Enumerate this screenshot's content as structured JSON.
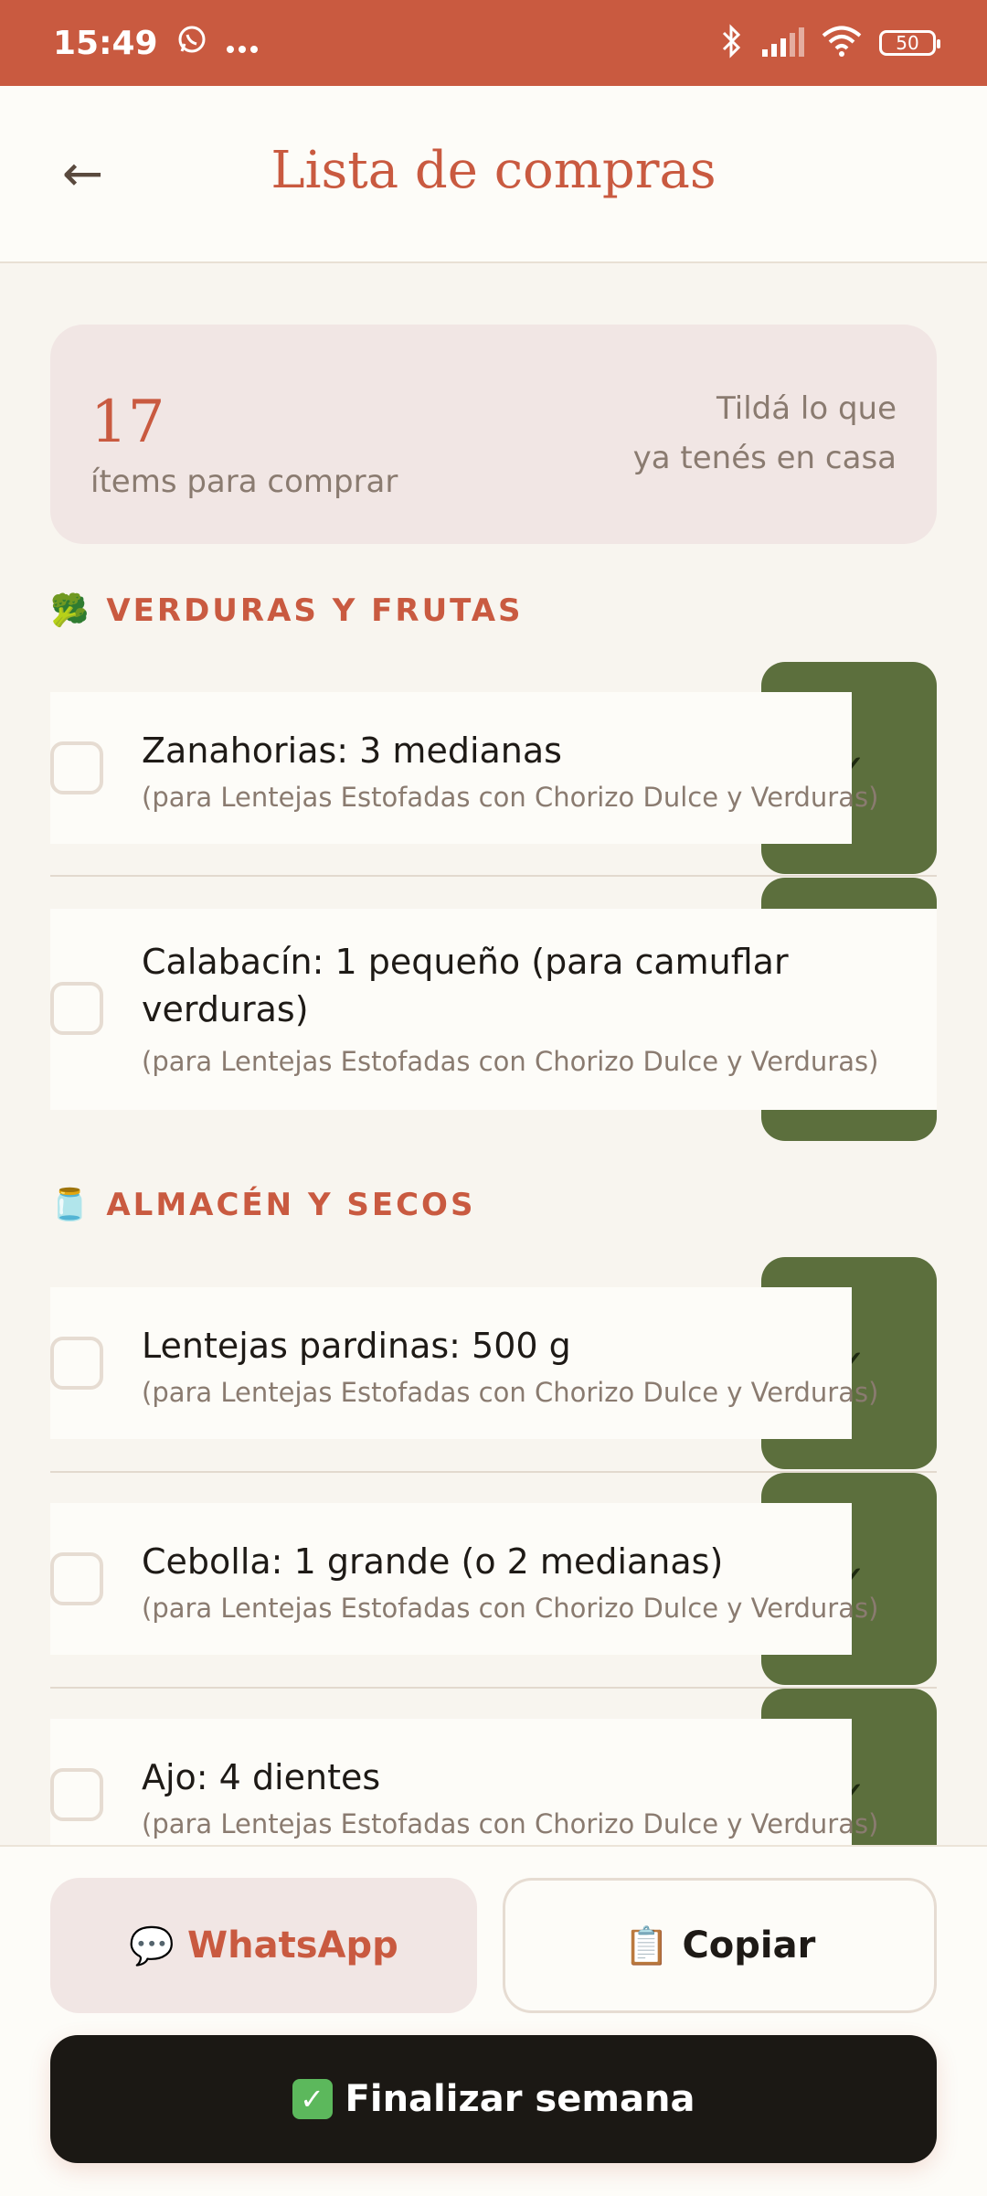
{
  "status": {
    "time": "15:49",
    "battery": "50"
  },
  "header": {
    "back": "←",
    "title": "Lista de compras"
  },
  "summary": {
    "count": "17",
    "count_label": "ítems para comprar",
    "hint_line1": "Tildá lo que",
    "hint_line2": "ya tenés en casa"
  },
  "sections": [
    {
      "icon": "🥦",
      "title": "VERDURAS Y FRUTAS",
      "items": [
        {
          "name": "Zanahorias: 3 medianas",
          "note": "(para Lentejas Estofadas con Chorizo Dulce y Verduras)"
        },
        {
          "name_line1": "Calabacín: 1 pequeño (para camuflar",
          "name_line2": "verduras)",
          "note": "(para Lentejas Estofadas con Chorizo Dulce y Verduras)"
        }
      ]
    },
    {
      "icon": "🫙",
      "title": "ALMACÉN Y SECOS",
      "items": [
        {
          "name": "Lentejas pardinas: 500 g",
          "note": "(para Lentejas Estofadas con Chorizo Dulce y Verduras)"
        },
        {
          "name": "Cebolla: 1 grande (o 2 medianas)",
          "note": "(para Lentejas Estofadas con Chorizo Dulce y Verduras)"
        },
        {
          "name": "Ajo: 4 dientes",
          "note": "(para Lentejas Estofadas con Chorizo Dulce y Verduras)"
        }
      ]
    }
  ],
  "actions": {
    "whatsapp_icon": "💬",
    "whatsapp_label": "WhatsApp",
    "copy_icon": "📋",
    "copy_label": "Copiar",
    "finish_icon": "✓",
    "finish_label": "Finalizar semana"
  },
  "colors": {
    "accent": "#c95a40",
    "swipe_green": "#5c6f3d",
    "dark_button": "#1b1814"
  }
}
